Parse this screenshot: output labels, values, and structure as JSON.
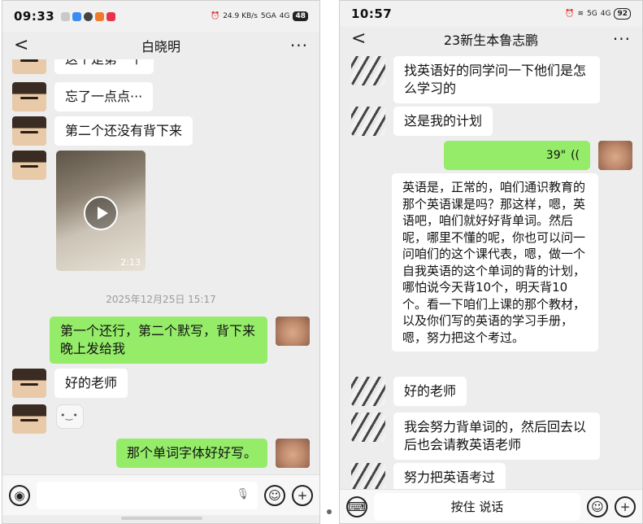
{
  "left_phone": {
    "status": {
      "time": "09:33",
      "net": "24.9 KB/s",
      "signal_1": "5GA",
      "signal_2": "4G",
      "battery": "48"
    },
    "header": {
      "back": "<",
      "title": "白晓明",
      "more": "···"
    },
    "messages": [
      {
        "text": "这个是第一个"
      },
      {
        "text": "忘了一点点···"
      },
      {
        "text": "第二个还没有背下来"
      }
    ],
    "video": {
      "duration": "2:13"
    },
    "timestamp": "2025年12月25日 15:17",
    "sent_1": "第一个还行，第二个默写，背下来晚上发给我",
    "reply_1": "好的老师",
    "sent_2": "那个单词字体好好写。",
    "input": {
      "mic": "🎙"
    }
  },
  "right_phone": {
    "status": {
      "time": "10:57",
      "net": "5G",
      "signal": "4G",
      "battery": "92"
    },
    "header": {
      "back": "<",
      "title": "23新生本鲁志鹏",
      "more": "···"
    },
    "msg_1": "找英语好的同学问一下他们是怎么学习的",
    "msg_2": "这是我的计划",
    "voice": {
      "duration": "39\"",
      "icon": "(("
    },
    "msg_long": "英语是，正常的，咱们通识教育的那个英语课是吗？那这样，嗯，英语吧，咱们就好好背单词。然后呢，哪里不懂的呢，你也可以问一问咱们的这个课代表，嗯，做一个自我英语的这个单词的背的计划，哪怕说今天背10个，明天背10个。看一下咱们上课的那个教材，以及你们写的英语的学习手册，嗯，努力把这个考过。",
    "msg_3": "好的老师",
    "msg_4": "我会努力背单词的，然后回去以后也会请教英语老师",
    "msg_5": "努力把英语考过",
    "input": {
      "hold_talk": "按住 说话"
    }
  },
  "colors": {
    "sent_bubble": "#95ec69",
    "recv_bubble": "#ffffff",
    "chat_bg": "#ededed"
  },
  "icons": [
    "back-arrow-icon",
    "more-icon",
    "voice-icon",
    "emoji-icon",
    "plus-icon",
    "keyboard-icon",
    "mic-icon",
    "play-icon"
  ]
}
